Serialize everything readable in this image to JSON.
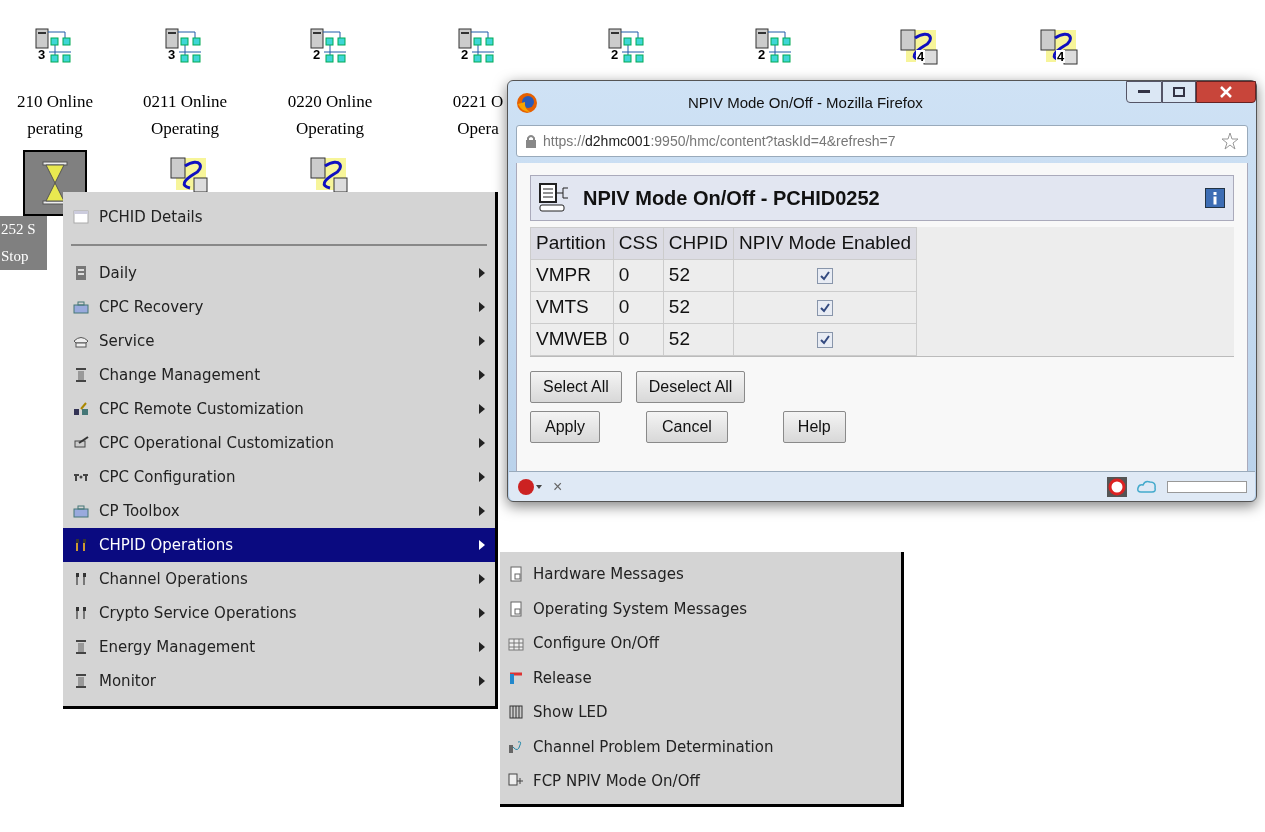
{
  "desktop": {
    "icons": [
      {
        "kind": "network",
        "number": "3",
        "selected": false,
        "label": [
          "210 Online",
          "perating"
        ]
      },
      {
        "kind": "network",
        "number": "3",
        "selected": false,
        "label": [
          "0211 Online",
          "Operating"
        ]
      },
      {
        "kind": "network",
        "number": "2",
        "selected": false,
        "label": [
          "0220 Online",
          "Operating"
        ]
      },
      {
        "kind": "network",
        "number": "2",
        "selected": false,
        "label": [
          "0221 O",
          "Opera"
        ]
      },
      {
        "kind": "network",
        "number": "2",
        "selected": false
      },
      {
        "kind": "network",
        "number": "2",
        "selected": false
      },
      {
        "kind": "linked",
        "number": "4",
        "selected": false
      },
      {
        "kind": "linked",
        "number": "4",
        "selected": false
      },
      {
        "kind": "hourglass",
        "selected": true,
        "label": [
          "252 S",
          "Stop"
        ]
      },
      {
        "kind": "linked",
        "selected": false
      },
      {
        "kind": "linked",
        "selected": false
      }
    ]
  },
  "context_menu": {
    "items": [
      {
        "kind": "item",
        "label": "PCHID Details",
        "has_submenu": false,
        "selected": false
      },
      {
        "kind": "separator"
      },
      {
        "kind": "item",
        "label": "Daily",
        "has_submenu": true,
        "selected": false
      },
      {
        "kind": "item",
        "label": "CPC Recovery",
        "has_submenu": true,
        "selected": false
      },
      {
        "kind": "item",
        "label": "Service",
        "has_submenu": true,
        "selected": false
      },
      {
        "kind": "item",
        "label": "Change Management",
        "has_submenu": true,
        "selected": false
      },
      {
        "kind": "item",
        "label": "CPC Remote Customization",
        "has_submenu": true,
        "selected": false
      },
      {
        "kind": "item",
        "label": "CPC Operational Customization",
        "has_submenu": true,
        "selected": false
      },
      {
        "kind": "item",
        "label": "CPC Configuration",
        "has_submenu": true,
        "selected": false
      },
      {
        "kind": "item",
        "label": "CP Toolbox",
        "has_submenu": true,
        "selected": false
      },
      {
        "kind": "item",
        "label": "CHPID Operations",
        "has_submenu": true,
        "selected": true
      },
      {
        "kind": "item",
        "label": "Channel Operations",
        "has_submenu": true,
        "selected": false
      },
      {
        "kind": "item",
        "label": "Crypto Service Operations",
        "has_submenu": true,
        "selected": false
      },
      {
        "kind": "item",
        "label": "Energy Management",
        "has_submenu": true,
        "selected": false
      },
      {
        "kind": "item",
        "label": "Monitor",
        "has_submenu": true,
        "selected": false
      }
    ]
  },
  "submenu": {
    "items": [
      "Hardware Messages",
      "Operating System Messages",
      "Configure On/Off",
      "Release",
      "Show LED",
      "Channel Problem Determination",
      "FCP NPIV Mode On/Off"
    ]
  },
  "browser_window": {
    "title": "NPIV Mode On/Off - Mozilla Firefox",
    "url": {
      "scheme": "https://",
      "host": "d2hmc001",
      "rest": ":9950/hmc/content?taskId=4&refresh=7"
    },
    "panel_title": "NPIV Mode On/Off - PCHID0252",
    "table": {
      "columns": [
        "Partition",
        "CSS",
        "CHPID",
        "NPIV Mode Enabled"
      ],
      "rows": [
        {
          "partition": "VMPR",
          "css": "0",
          "chpid": "52",
          "checked": true
        },
        {
          "partition": "VMTS",
          "css": "0",
          "chpid": "52",
          "checked": true
        },
        {
          "partition": "VMWEB",
          "css": "0",
          "chpid": "52",
          "checked": true
        }
      ]
    },
    "buttons_row1": [
      "Select All",
      "Deselect All"
    ],
    "buttons_row2": [
      "Apply",
      "Cancel",
      "Help"
    ],
    "status_bar": {
      "close": "×"
    }
  }
}
